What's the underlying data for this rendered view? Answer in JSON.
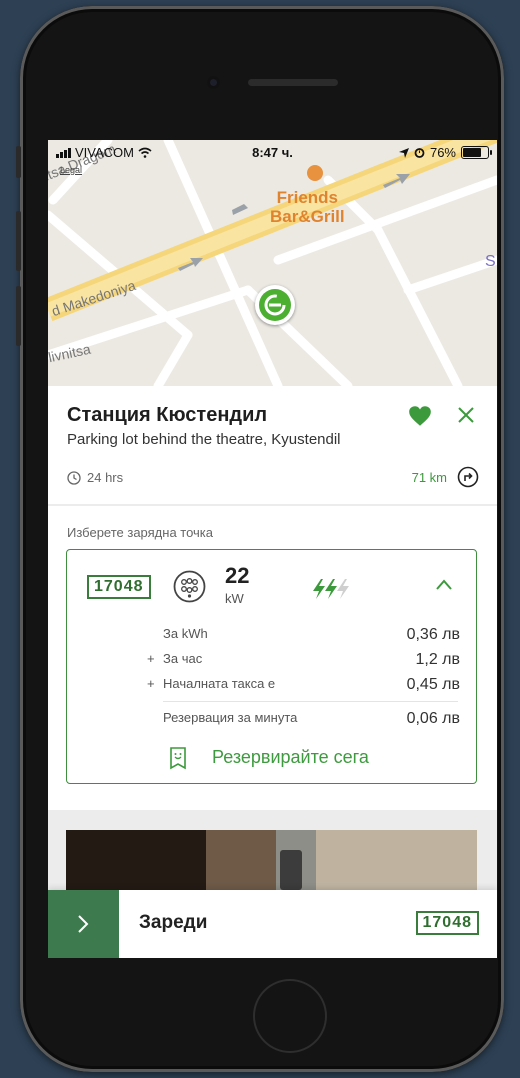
{
  "status_bar": {
    "carrier": "VIVACOM",
    "time": "8:47 ч.",
    "battery": "76%"
  },
  "map": {
    "legal": "Legal",
    "poi_line1": "Friends",
    "poi_line2": "Bar&Grill",
    "streets": [
      "itsa Dragom",
      "d Makedoniya",
      "livnitsa"
    ],
    "edge_label": "S"
  },
  "station": {
    "name": "Станция Кюстендил",
    "address": "Parking lot behind the theatre, Kyustendil",
    "hours": "24 hrs",
    "distance": "71 km"
  },
  "charge_point": {
    "section_label": "Изберете зарядна точка",
    "id": "17048",
    "power": "22",
    "unit": "kW",
    "rates": [
      {
        "prefix": "",
        "label": "За kWh",
        "value": "0,36 лв"
      },
      {
        "prefix": "+",
        "label": "За час",
        "value": "1,2 лв"
      },
      {
        "prefix": "+",
        "label": "Началната такса е",
        "value": "0,45 лв"
      }
    ],
    "reservation": {
      "label": "Резервация за минута",
      "value": "0,06 лв"
    },
    "reserve_button": "Резервирайте сега"
  },
  "bottom_bar": {
    "label": "Зареди",
    "id": "17048"
  },
  "colors": {
    "accent": "#3e9a3e",
    "dark_green": "#3d7b4e",
    "poi": "#e0832f"
  }
}
